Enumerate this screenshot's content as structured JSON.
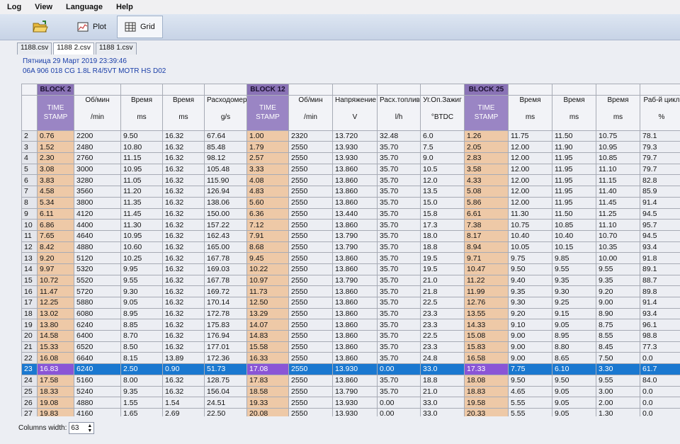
{
  "menu": [
    "Log",
    "View",
    "Language",
    "Help"
  ],
  "toolbar": {
    "plot_label": "Plot",
    "grid_label": "Grid"
  },
  "tabs": [
    "1188.csv",
    "1188 2.csv",
    "1188 1.csv"
  ],
  "info": {
    "date": "Пятница 29 Март 2019 23:39:46",
    "ecu": "06A 906 018 CG  1.8L R4/5VT MOTR HS D02"
  },
  "blocks": {
    "b2": "BLOCK 2",
    "b12": "BLOCK 12",
    "b25": "BLOCK 25"
  },
  "headers": [
    {
      "t": "TIME STAMP",
      "u": ""
    },
    {
      "t": "Об/мин",
      "u": "/min"
    },
    {
      "t": "Время",
      "u": "ms"
    },
    {
      "t": "Время",
      "u": "ms"
    },
    {
      "t": "Расходомер",
      "u": "g/s"
    },
    {
      "t": "TIME STAMP",
      "u": ""
    },
    {
      "t": "Об/мин",
      "u": "/min"
    },
    {
      "t": "Напряжение",
      "u": "V"
    },
    {
      "t": "Расх.топлива",
      "u": "l/h"
    },
    {
      "t": "Уг.Оп.Зажиг",
      "u": "°BTDC"
    },
    {
      "t": "TIME STAMP",
      "u": ""
    },
    {
      "t": "Время",
      "u": "ms"
    },
    {
      "t": "Время",
      "u": "ms"
    },
    {
      "t": "Время",
      "u": "ms"
    },
    {
      "t": "Раб-й цикл",
      "u": "%"
    }
  ],
  "rows": [
    [
      "2",
      "0.76",
      "2200",
      "9.50",
      "16.32",
      "67.64",
      "1.00",
      "2320",
      "13.720",
      "32.48",
      "6.0",
      "1.26",
      "11.75",
      "11.50",
      "10.75",
      "78.1"
    ],
    [
      "3",
      "1.52",
      "2480",
      "10.80",
      "16.32",
      "85.48",
      "1.79",
      "2550",
      "13.930",
      "35.70",
      "7.5",
      "2.05",
      "12.00",
      "11.90",
      "10.95",
      "79.3"
    ],
    [
      "4",
      "2.30",
      "2760",
      "11.15",
      "16.32",
      "98.12",
      "2.57",
      "2550",
      "13.930",
      "35.70",
      "9.0",
      "2.83",
      "12.00",
      "11.95",
      "10.85",
      "79.7"
    ],
    [
      "5",
      "3.08",
      "3000",
      "10.95",
      "16.32",
      "105.48",
      "3.33",
      "2550",
      "13.860",
      "35.70",
      "10.5",
      "3.58",
      "12.00",
      "11.95",
      "11.10",
      "79.7"
    ],
    [
      "6",
      "3.83",
      "3280",
      "11.05",
      "16.32",
      "115.90",
      "4.08",
      "2550",
      "13.860",
      "35.70",
      "12.0",
      "4.33",
      "12.00",
      "11.95",
      "11.15",
      "82.8"
    ],
    [
      "7",
      "4.58",
      "3560",
      "11.20",
      "16.32",
      "126.94",
      "4.83",
      "2550",
      "13.860",
      "35.70",
      "13.5",
      "5.08",
      "12.00",
      "11.95",
      "11.40",
      "85.9"
    ],
    [
      "8",
      "5.34",
      "3800",
      "11.35",
      "16.32",
      "138.06",
      "5.60",
      "2550",
      "13.860",
      "35.70",
      "15.0",
      "5.86",
      "12.00",
      "11.95",
      "11.45",
      "91.4"
    ],
    [
      "9",
      "6.11",
      "4120",
      "11.45",
      "16.32",
      "150.00",
      "6.36",
      "2550",
      "13.440",
      "35.70",
      "15.8",
      "6.61",
      "11.30",
      "11.50",
      "11.25",
      "94.5"
    ],
    [
      "10",
      "6.86",
      "4400",
      "11.30",
      "16.32",
      "157.22",
      "7.12",
      "2550",
      "13.860",
      "35.70",
      "17.3",
      "7.38",
      "10.75",
      "10.85",
      "11.10",
      "95.7"
    ],
    [
      "11",
      "7.65",
      "4640",
      "10.95",
      "16.32",
      "162.43",
      "7.91",
      "2550",
      "13.790",
      "35.70",
      "18.0",
      "8.17",
      "10.40",
      "10.40",
      "10.70",
      "94.5"
    ],
    [
      "12",
      "8.42",
      "4880",
      "10.60",
      "16.32",
      "165.00",
      "8.68",
      "2550",
      "13.790",
      "35.70",
      "18.8",
      "8.94",
      "10.05",
      "10.15",
      "10.35",
      "93.4"
    ],
    [
      "13",
      "9.20",
      "5120",
      "10.25",
      "16.32",
      "167.78",
      "9.45",
      "2550",
      "13.860",
      "35.70",
      "19.5",
      "9.71",
      "9.75",
      "9.85",
      "10.00",
      "91.8"
    ],
    [
      "14",
      "9.97",
      "5320",
      "9.95",
      "16.32",
      "169.03",
      "10.22",
      "2550",
      "13.860",
      "35.70",
      "19.5",
      "10.47",
      "9.50",
      "9.55",
      "9.55",
      "89.1"
    ],
    [
      "15",
      "10.72",
      "5520",
      "9.55",
      "16.32",
      "167.78",
      "10.97",
      "2550",
      "13.790",
      "35.70",
      "21.0",
      "11.22",
      "9.40",
      "9.35",
      "9.35",
      "88.7"
    ],
    [
      "16",
      "11.47",
      "5720",
      "9.30",
      "16.32",
      "169.72",
      "11.73",
      "2550",
      "13.860",
      "35.70",
      "21.8",
      "11.99",
      "9.35",
      "9.30",
      "9.20",
      "89.8"
    ],
    [
      "17",
      "12.25",
      "5880",
      "9.05",
      "16.32",
      "170.14",
      "12.50",
      "2550",
      "13.860",
      "35.70",
      "22.5",
      "12.76",
      "9.30",
      "9.25",
      "9.00",
      "91.4"
    ],
    [
      "18",
      "13.02",
      "6080",
      "8.95",
      "16.32",
      "172.78",
      "13.29",
      "2550",
      "13.860",
      "35.70",
      "23.3",
      "13.55",
      "9.20",
      "9.15",
      "8.90",
      "93.4"
    ],
    [
      "19",
      "13.80",
      "6240",
      "8.85",
      "16.32",
      "175.83",
      "14.07",
      "2550",
      "13.860",
      "35.70",
      "23.3",
      "14.33",
      "9.10",
      "9.05",
      "8.75",
      "96.1"
    ],
    [
      "20",
      "14.58",
      "6400",
      "8.70",
      "16.32",
      "176.94",
      "14.83",
      "2550",
      "13.860",
      "35.70",
      "22.5",
      "15.08",
      "9.00",
      "8.95",
      "8.55",
      "98.8"
    ],
    [
      "21",
      "15.33",
      "6520",
      "8.50",
      "16.32",
      "177.01",
      "15.58",
      "2550",
      "13.860",
      "35.70",
      "23.3",
      "15.83",
      "9.00",
      "8.80",
      "8.45",
      "77.3"
    ],
    [
      "22",
      "16.08",
      "6640",
      "8.15",
      "13.89",
      "172.36",
      "16.33",
      "2550",
      "13.860",
      "35.70",
      "24.8",
      "16.58",
      "9.00",
      "8.65",
      "7.50",
      "0.0"
    ],
    [
      "23",
      "16.83",
      "6240",
      "2.50",
      "0.90",
      "51.73",
      "17.08",
      "2550",
      "13.930",
      "0.00",
      "33.0",
      "17.33",
      "7.75",
      "6.10",
      "3.30",
      "61.7"
    ],
    [
      "24",
      "17.58",
      "5160",
      "8.00",
      "16.32",
      "128.75",
      "17.83",
      "2550",
      "13.860",
      "35.70",
      "18.8",
      "18.08",
      "9.50",
      "9.50",
      "9.55",
      "84.0"
    ],
    [
      "25",
      "18.33",
      "5240",
      "9.35",
      "16.32",
      "156.04",
      "18.58",
      "2550",
      "13.790",
      "35.70",
      "21.0",
      "18.83",
      "4.65",
      "9.05",
      "3.00",
      "0.0"
    ],
    [
      "26",
      "19.08",
      "4880",
      "1.55",
      "1.54",
      "24.51",
      "19.33",
      "2550",
      "13.930",
      "0.00",
      "33.0",
      "19.58",
      "5.55",
      "9.05",
      "2.00",
      "0.0"
    ],
    [
      "27",
      "19.83",
      "4160",
      "1.65",
      "2.69",
      "22.50",
      "20.08",
      "2550",
      "13.930",
      "0.00",
      "33.0",
      "20.33",
      "5.55",
      "9.05",
      "1.30",
      "0.0"
    ]
  ],
  "selected_row": "23",
  "footer": {
    "columns_width_label": "Columns width:",
    "columns_width_value": "63"
  },
  "colors": {
    "block_header": "#8a73b6",
    "timestamp_cell": "#eec9a7",
    "selection": "#1a78d0"
  }
}
